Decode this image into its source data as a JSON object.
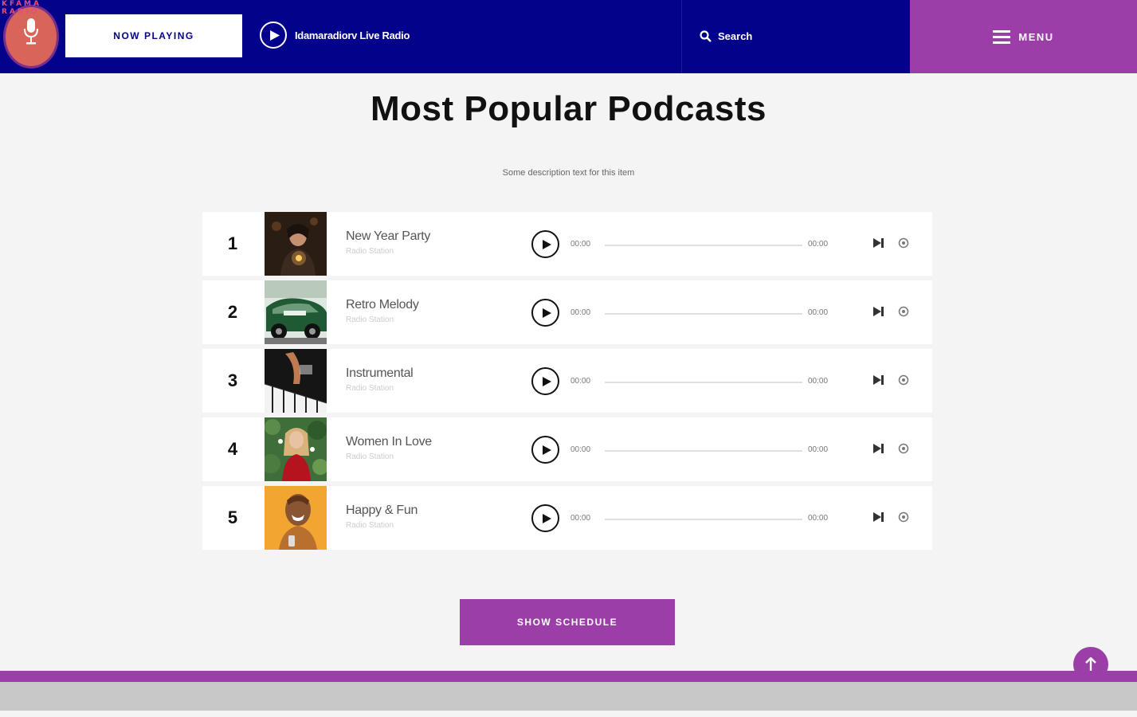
{
  "header": {
    "logo_text": "KFAMA RADIO",
    "now_playing_label": "NOW PLAYING",
    "live_label": "Idamaradiorv Live Radio",
    "search_label": "Search",
    "menu_label": "MENU"
  },
  "main": {
    "title": "Most Popular Podcasts",
    "description": "Some description text for this item"
  },
  "podcasts": [
    {
      "rank": "1",
      "title": "New Year Party",
      "subtitle": "Radio Station",
      "time_start": "00:00",
      "time_end": "00:00",
      "progress": 0
    },
    {
      "rank": "2",
      "title": "Retro Melody",
      "subtitle": "Radio Station",
      "time_start": "00:00",
      "time_end": "00:00",
      "progress": 0
    },
    {
      "rank": "3",
      "title": "Instrumental",
      "subtitle": "Radio Station",
      "time_start": "00:00",
      "time_end": "00:00",
      "progress": 0
    },
    {
      "rank": "4",
      "title": "Women In Love",
      "subtitle": "Radio Station",
      "time_start": "00:00",
      "time_end": "00:00",
      "progress": 0
    },
    {
      "rank": "5",
      "title": "Happy & Fun",
      "subtitle": "Radio Station",
      "time_start": "00:00",
      "time_end": "00:00",
      "progress": 0
    }
  ],
  "actions": {
    "show_schedule_label": "SHOW SCHEDULE"
  },
  "icons": {
    "play": "play-icon",
    "search": "search-icon",
    "menu": "hamburger-icon",
    "skip": "skip-forward-icon",
    "settings": "settings-icon",
    "back_to_top": "arrow-up-icon"
  },
  "colors": {
    "header_bg": "#03028a",
    "accent": "#9b3ea8",
    "page_bg": "#f4f4f4"
  }
}
